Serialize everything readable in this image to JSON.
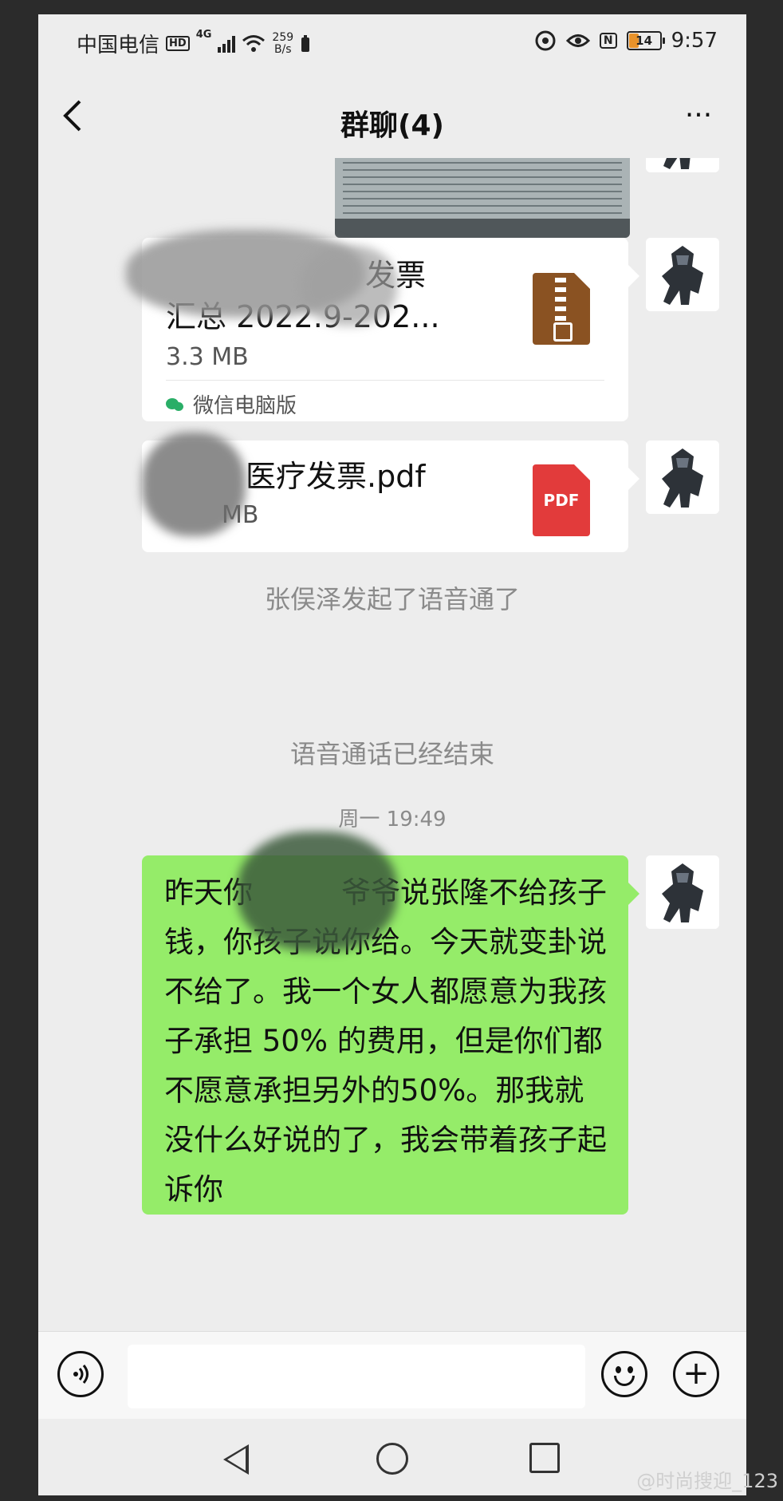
{
  "status_bar": {
    "carrier": "中国电信",
    "hd": "HD",
    "network": "4G",
    "speed_value": "259",
    "speed_unit": "B/s",
    "nfc": "N",
    "battery": "14",
    "time": "9:57"
  },
  "header": {
    "back_icon": "chevron-left-icon",
    "title": "群聊(4)",
    "more_label": "···"
  },
  "messages": {
    "file1": {
      "name_line1": "发票",
      "name_line2": "汇总 2022.9-202...",
      "size": "3.3 MB",
      "source": "微信电脑版",
      "icon": "zip-file-icon"
    },
    "file2": {
      "name": "医疗发票.pdf",
      "size": "MB",
      "icon_label": "PDF"
    },
    "system1": "张俣泽发起了语音通了",
    "system2": "语音通话已经结束",
    "timestamp": "周一 19:49",
    "text_message": "昨天你　　　爷爷说张隆不给孩子钱，你孩子说你给。今天就变卦说不给了。我一个女人都愿意为我孩子承担 50% 的费用，但是你们都不愿意承担另外的50%。那我就没什么好说的了，我会带着孩子起诉你"
  },
  "input_bar": {
    "voice_icon": "voice-icon",
    "emoji_icon": "emoji-icon",
    "plus_label": "+"
  },
  "watermark": "@时尚搜迎_123",
  "colors": {
    "chat_bg": "#ededed",
    "my_bubble": "#95ec69",
    "wechat_green": "#2aae67",
    "pdf_red": "#e23b3b",
    "zip_brown": "#8a5222"
  }
}
